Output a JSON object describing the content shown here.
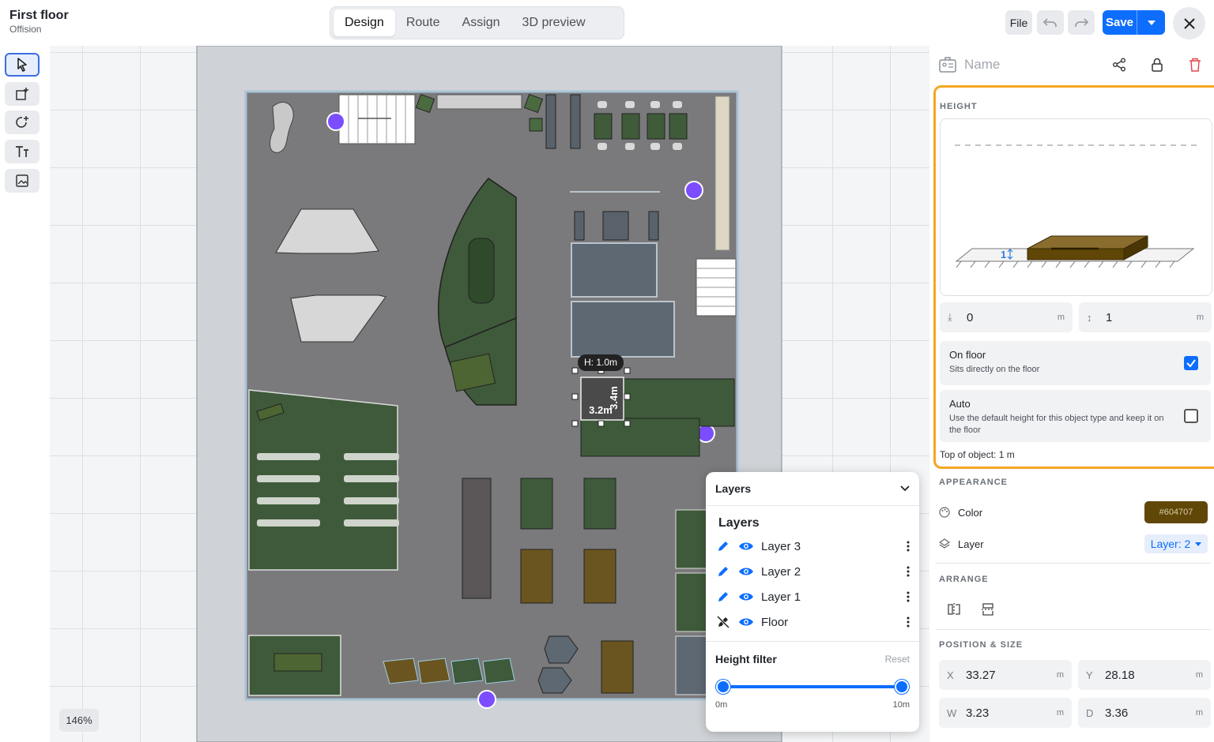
{
  "header": {
    "title": "First floor",
    "subtitle": "Offision",
    "tabs": [
      {
        "label": "Design",
        "active": true
      },
      {
        "label": "Route",
        "active": false
      },
      {
        "label": "Assign",
        "active": false
      },
      {
        "label": "3D preview",
        "active": false
      }
    ],
    "file_label": "File",
    "save_label": "Save"
  },
  "toolbar": {
    "tools": [
      "select-pointer-icon",
      "add-area-icon",
      "rotate-plus-icon",
      "text-tool-icon",
      "image-icon"
    ]
  },
  "canvas": {
    "zoom": "146%",
    "selection": {
      "height_tooltip": "H: 1.0m",
      "width_label": "3.2m",
      "depth_label": "3.4m"
    }
  },
  "layers_panel": {
    "header": "Layers",
    "title": "Layers",
    "layers": [
      {
        "name": "Layer 3",
        "icon": "pencil-icon"
      },
      {
        "name": "Layer 2",
        "icon": "pencil-icon"
      },
      {
        "name": "Layer 1",
        "icon": "pencil-icon"
      },
      {
        "name": "Floor",
        "icon": "pencil-off-icon"
      }
    ],
    "height_filter": {
      "label": "Height filter",
      "reset_label": "Reset",
      "min_label": "0m",
      "max_label": "10m"
    }
  },
  "properties": {
    "name_placeholder": "Name",
    "height": {
      "section_label": "HEIGHT",
      "diagram_label": "1",
      "elevation_value": "0",
      "height_value": "1",
      "unit": "m",
      "on_floor": {
        "title": "On floor",
        "description": "Sits directly on the floor",
        "checked": true
      },
      "auto": {
        "title": "Auto",
        "description": "Use the default height for this object type and keep it on the floor",
        "checked": false
      },
      "top_of_object": "Top of object: 1 m"
    },
    "appearance": {
      "section_label": "APPEARANCE",
      "color_label": "Color",
      "color_value": "#604707",
      "layer_label": "Layer",
      "layer_value": "Layer: 2"
    },
    "arrange": {
      "section_label": "ARRANGE"
    },
    "position_size": {
      "section_label": "POSITION & SIZE",
      "x_label": "X",
      "x_value": "33.27",
      "y_label": "Y",
      "y_value": "28.18",
      "w_label": "W",
      "w_value": "3.23",
      "d_label": "D",
      "d_value": "3.36",
      "unit": "m"
    }
  },
  "colors": {
    "accent": "#0d6efd",
    "highlight": "#f5a623",
    "object": "#604707"
  }
}
